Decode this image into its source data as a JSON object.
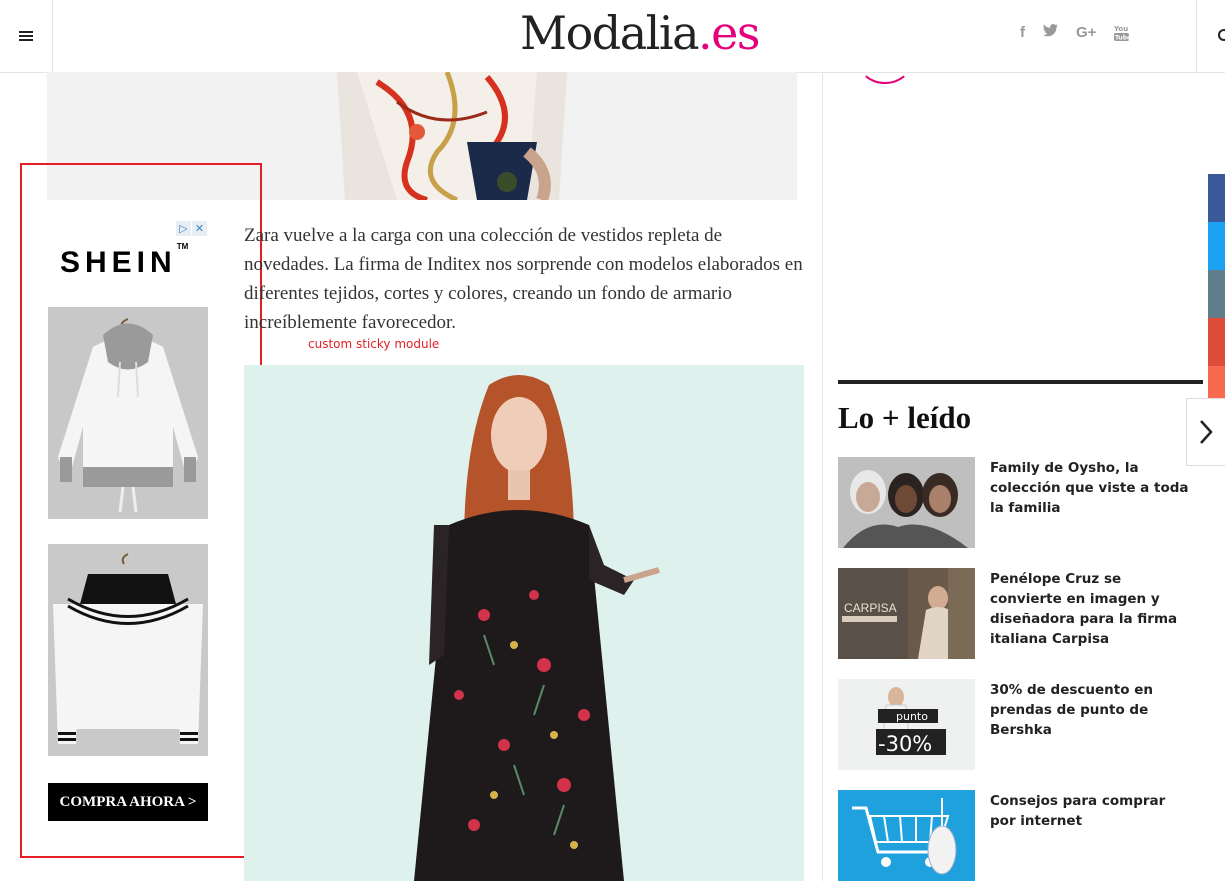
{
  "header": {
    "logo_main": "Modalia",
    "logo_tld": ".es",
    "social": [
      "f",
      "t",
      "G+",
      "You Tube"
    ]
  },
  "ad": {
    "brand": "SHEIN",
    "cta": "COMPRA AHORA >",
    "choices": [
      "▷",
      "✕"
    ]
  },
  "article": {
    "intro": "Zara vuelve a la carga con una colección de vestidos repleta de novedades. La firma de Inditex nos sorprende con modelos elaborados en diferentes tejidos, cortes y colores, creando un fondo de armario increíblemente favorecedor.",
    "sticky_label": "custom sticky module"
  },
  "sidebar": {
    "section_title": "Lo + leído",
    "items": [
      {
        "title": "Family de Oysho, la colección que viste a toda la familia"
      },
      {
        "title": "Penélope Cruz se convierte en imagen y diseñadora para la firma italiana Carpisa",
        "thumb_text": "CARPISA"
      },
      {
        "title": "30% de descuento en prendas de punto de Bershka",
        "thumb_label": "punto",
        "thumb_percent": "-30%"
      },
      {
        "title": "Consejos para comprar por internet"
      }
    ]
  },
  "share_colors": [
    "#3b5998",
    "#1da1f2",
    "#607d8b",
    "#dd4b39",
    "#f86a4d"
  ]
}
